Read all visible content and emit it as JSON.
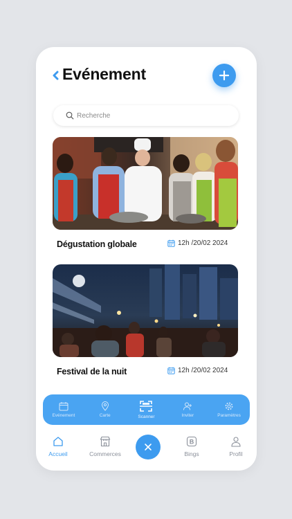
{
  "header": {
    "title": "Evénement",
    "back_icon": "chevron-left-icon",
    "add_icon": "plus-icon"
  },
  "search": {
    "placeholder": "Recherche",
    "value": "",
    "icon": "search-icon"
  },
  "events": [
    {
      "title": "Dégustation  globale",
      "date": "12h /20/02 2024",
      "image": "cooking-class-photo",
      "date_icon": "calendar-icon"
    },
    {
      "title": "Festival de la nuit",
      "date": "12h /20/02 2024",
      "image": "night-market-photo",
      "date_icon": "calendar-icon"
    }
  ],
  "action_bar": {
    "items": [
      {
        "label": "Evénement",
        "icon": "calendar-icon"
      },
      {
        "label": "Carte",
        "icon": "map-pin-icon"
      },
      {
        "label": "Scanner",
        "icon": "scan-icon"
      },
      {
        "label": "Inviter",
        "icon": "add-user-icon"
      },
      {
        "label": "Paramètres",
        "icon": "gear-icon"
      }
    ]
  },
  "bottom_nav": {
    "items": [
      {
        "label": "Accueil",
        "icon": "home-icon",
        "active": true
      },
      {
        "label": "Commerces",
        "icon": "store-icon"
      },
      {
        "label": "Bings",
        "icon": "b-badge-icon"
      },
      {
        "label": "Profil",
        "icon": "user-icon"
      }
    ],
    "center_icon": "close-icon"
  },
  "colors": {
    "accent": "#3d9bef",
    "action_bar": "#4aa4f2",
    "background": "#e3e5e9"
  }
}
